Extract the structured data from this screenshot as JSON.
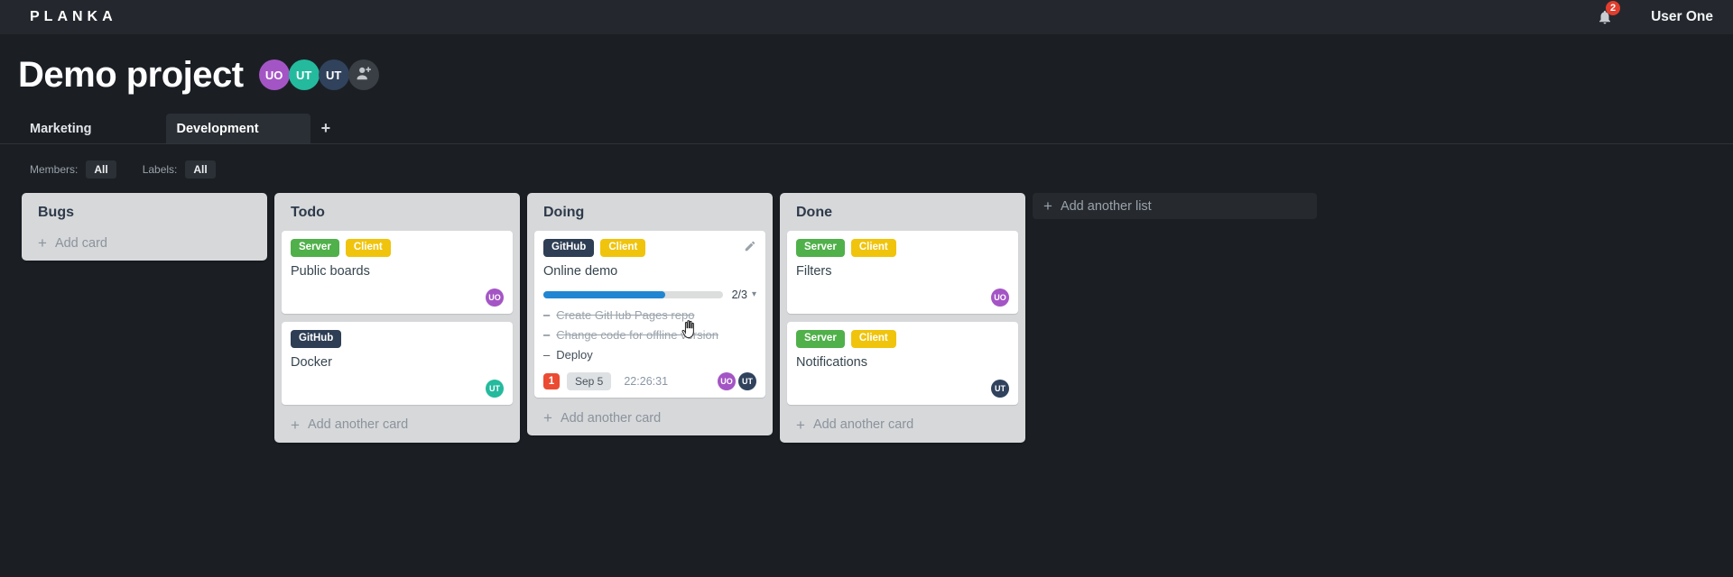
{
  "topbar": {
    "logo": "PLANKA",
    "notification_count": "2",
    "user_name": "User One"
  },
  "project": {
    "title": "Demo project",
    "members": [
      {
        "initials": "UO",
        "color": "#a455c5"
      },
      {
        "initials": "UT",
        "color": "#24ba9d"
      },
      {
        "initials": "UT",
        "color": "#30425c"
      }
    ]
  },
  "tabs": {
    "items": [
      {
        "label": "Marketing"
      },
      {
        "label": "Development"
      }
    ]
  },
  "filters": {
    "members_label": "Members:",
    "members_value": "All",
    "labels_label": "Labels:",
    "labels_value": "All"
  },
  "board": {
    "lists": [
      {
        "title": "Bugs",
        "footer": "Add card",
        "cards": []
      },
      {
        "title": "Todo",
        "footer": "Add another card",
        "cards": [
          {
            "title": "Public boards",
            "labels": [
              {
                "text": "Server",
                "color": "#50b04a"
              },
              {
                "text": "Client",
                "color": "#f0c40c"
              }
            ],
            "members": [
              {
                "initials": "UO",
                "color": "#a455c5"
              }
            ]
          },
          {
            "title": "Docker",
            "labels": [
              {
                "text": "GitHub",
                "color": "#2e3e54"
              }
            ],
            "members": [
              {
                "initials": "UT",
                "color": "#24ba9d"
              }
            ]
          }
        ]
      },
      {
        "title": "Doing",
        "footer": "Add another card",
        "cards": [
          {
            "title": "Online demo",
            "labels": [
              {
                "text": "GitHub",
                "color": "#2e3e54"
              },
              {
                "text": "Client",
                "color": "#f0c40c"
              }
            ],
            "progress": {
              "text": "2/3",
              "percent_css": "68%"
            },
            "tasks": [
              {
                "text": "Create GitHub Pages repo",
                "done": true
              },
              {
                "text": "Change code for offline version",
                "done": true
              },
              {
                "text": "Deploy",
                "done": false
              }
            ],
            "notification_count": "1",
            "due_date": "Sep 5",
            "timer": "22:26:31",
            "members": [
              {
                "initials": "UO",
                "color": "#a455c5"
              },
              {
                "initials": "UT",
                "color": "#30425c"
              }
            ]
          }
        ]
      },
      {
        "title": "Done",
        "footer": "Add another card",
        "cards": [
          {
            "title": "Filters",
            "labels": [
              {
                "text": "Server",
                "color": "#50b04a"
              },
              {
                "text": "Client",
                "color": "#f0c40c"
              }
            ],
            "members": [
              {
                "initials": "UO",
                "color": "#a455c5"
              }
            ]
          },
          {
            "title": "Notifications",
            "labels": [
              {
                "text": "Server",
                "color": "#50b04a"
              },
              {
                "text": "Client",
                "color": "#f0c40c"
              }
            ],
            "members": [
              {
                "initials": "UT",
                "color": "#30425c"
              }
            ]
          }
        ]
      }
    ],
    "add_list_label": "Add another list"
  },
  "icons": {
    "plus": "+",
    "caret_down": "▾",
    "task_bullet": "–"
  },
  "colors": {
    "accent_progress": "#2086d2",
    "notification_red": "#eb4b33",
    "badge_red": "#e23d2d"
  }
}
